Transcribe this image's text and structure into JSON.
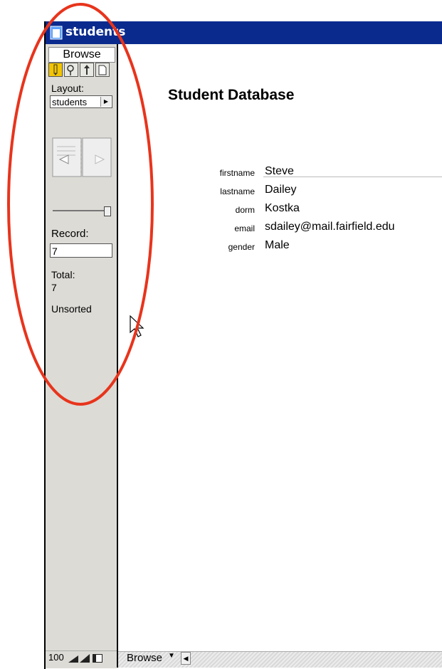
{
  "window": {
    "title": "students"
  },
  "sidebar": {
    "mode_tab": "Browse",
    "mode_icons": [
      "pencil-icon",
      "magnifier-icon",
      "tool-pointer-icon",
      "page-icon"
    ],
    "layout_label": "Layout:",
    "layout_value": "students",
    "record_label": "Record:",
    "record_value": "7",
    "total_label": "Total:",
    "total_value": "7",
    "sort_status": "Unsorted"
  },
  "content": {
    "title": "Student Database",
    "fields": [
      {
        "label": "firstname",
        "value": "Steve"
      },
      {
        "label": "lastname",
        "value": "Dailey"
      },
      {
        "label": "dorm",
        "value": "Kostka"
      },
      {
        "label": "email",
        "value": "sdailey@mail.fairfield.edu"
      },
      {
        "label": "gender",
        "value": "Male"
      }
    ]
  },
  "statusbar": {
    "zoom": "100",
    "mode": "Browse"
  },
  "colors": {
    "titlebar": "#0a2a8e",
    "annotation": "#e8341c",
    "sidebar": "#dcdbd6",
    "active_mode": "#f3c400"
  }
}
